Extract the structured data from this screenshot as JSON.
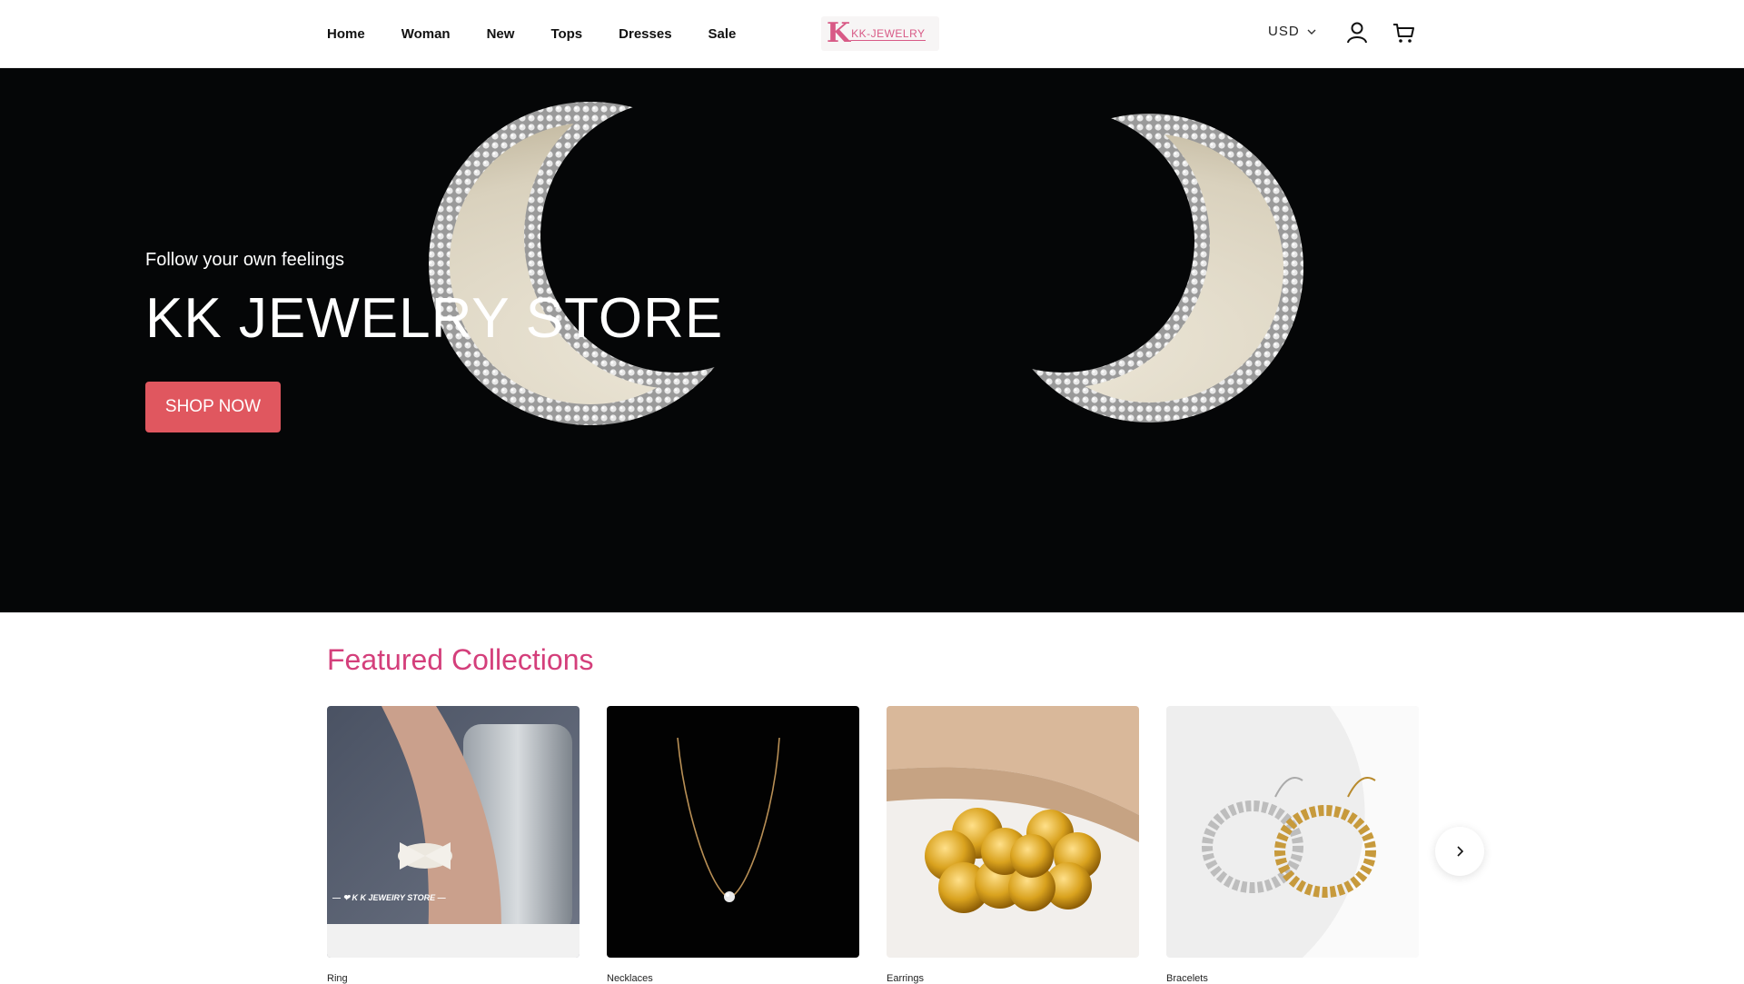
{
  "header": {
    "nav": [
      "Home",
      "Woman",
      "New",
      "Tops",
      "Dresses",
      "Sale"
    ],
    "logo_text": "KK-JEWELRY",
    "logo_mark": "K",
    "currency": "USD",
    "icons": [
      "chevron-down-icon",
      "user-icon",
      "cart-icon"
    ]
  },
  "hero": {
    "subtitle": "Follow your own feelings",
    "title": "KK JEWELRY STORE",
    "button": "SHOP NOW"
  },
  "featured": {
    "title": "Featured Collections",
    "cards": [
      {
        "label": "Ring",
        "caption": "— ❤ K K JEWEIRY STORE —"
      },
      {
        "label": "Necklaces"
      },
      {
        "label": "Earrings"
      },
      {
        "label": "Bracelets"
      }
    ]
  },
  "colors": {
    "accent": "#d43f7b",
    "button": "#e0575f",
    "hero_bg": "#050607"
  }
}
